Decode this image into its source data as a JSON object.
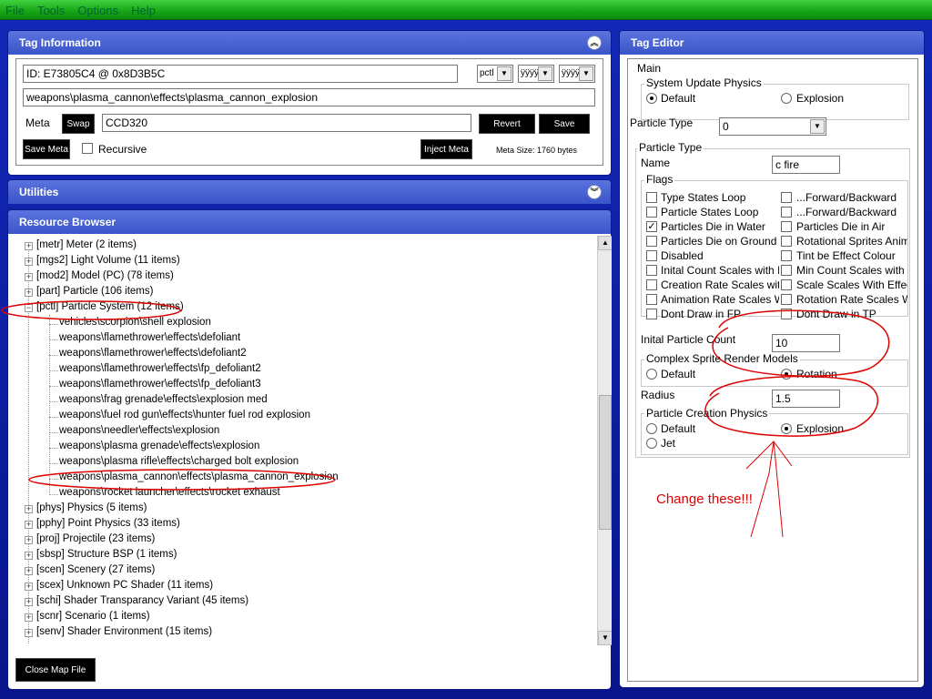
{
  "menu": [
    "File",
    "Tools",
    "Options",
    "Help"
  ],
  "tag_info": {
    "title": "Tag Information",
    "id_value": "ID: E73805C4 @ 0x8D3B5C",
    "type_select": "pctl",
    "select2": "ÿÿÿÿ",
    "select3": "ÿÿÿÿ",
    "path": "weapons\\plasma_cannon\\effects\\plasma_cannon_explosion",
    "meta_label": "Meta",
    "swap_label": "Swap",
    "meta_value": "CCD320",
    "revert_label": "Revert",
    "save_label": "Save",
    "save_meta_label": "Save Meta",
    "recursive_label": "Recursive",
    "inject_meta_label": "Inject Meta",
    "meta_size": "Meta Size: 1760 bytes"
  },
  "utilities": {
    "title": "Utilities"
  },
  "resource_browser": {
    "title": "Resource Browser",
    "close_map_label": "Close Map File",
    "top_items": [
      "[metr] Meter (2 items)",
      "[mgs2] Light Volume (11 items)",
      "[mod2] Model (PC) (78 items)",
      "[part] Particle (106 items)",
      "[pctl] Particle System (12 items)"
    ],
    "children": [
      "vehicles\\scorpion\\shell explosion",
      "weapons\\flamethrower\\effects\\defoliant",
      "weapons\\flamethrower\\effects\\defoliant2",
      "weapons\\flamethrower\\effects\\fp_defoliant2",
      "weapons\\flamethrower\\effects\\fp_defoliant3",
      "weapons\\frag grenade\\effects\\explosion med",
      "weapons\\fuel rod gun\\effects\\hunter fuel rod explosion",
      "weapons\\needler\\effects\\explosion",
      "weapons\\plasma grenade\\effects\\explosion",
      "weapons\\plasma rifle\\effects\\charged bolt explosion",
      "weapons\\plasma_cannon\\effects\\plasma_cannon_explosion",
      "weapons\\rocket launcher\\effects\\rocket exhaust"
    ],
    "bottom_items": [
      "[phys] Physics (5 items)",
      "[pphy] Point Physics (33 items)",
      "[proj] Projectile (23 items)",
      "[sbsp] Structure BSP (1 items)",
      "[scen] Scenery (27 items)",
      "[scex] Unknown PC Shader (11 items)",
      "[schi] Shader Transparancy Variant (45 items)",
      "[scnr] Scenario (1 items)",
      "[senv] Shader Environment (15 items)"
    ]
  },
  "tag_editor": {
    "title": "Tag Editor",
    "main_label": "Main",
    "system_update_physics": "System Update Physics",
    "sup_default": "Default",
    "sup_explosion": "Explosion",
    "particle_type_label": "Particle Type",
    "particle_type_value": "0",
    "particle_type_group": "Particle Type",
    "name_label": "Name",
    "name_value": "c fire",
    "flags_label": "Flags",
    "flags_left": [
      {
        "label": "Type States Loop",
        "checked": false
      },
      {
        "label": "Particle States Loop",
        "checked": false
      },
      {
        "label": "Particles Die in Water",
        "checked": true
      },
      {
        "label": "Particles Die on Ground",
        "checked": false
      },
      {
        "label": "Disabled",
        "checked": false
      },
      {
        "label": "Inital Count Scales with Eff",
        "checked": false
      },
      {
        "label": "Creation Rate Scales with",
        "checked": false
      },
      {
        "label": "Animation Rate Scales Witl",
        "checked": false
      },
      {
        "label": "Dont Draw in FP",
        "checked": false
      }
    ],
    "flags_right": [
      {
        "label": "...Forward/Backward",
        "checked": false
      },
      {
        "label": "...Forward/Backward",
        "checked": false
      },
      {
        "label": "Particles Die in Air",
        "checked": false
      },
      {
        "label": "Rotational Sprites Anima",
        "checked": false
      },
      {
        "label": "Tint be Effect Colour",
        "checked": false
      },
      {
        "label": "Min Count Scales with E",
        "checked": false
      },
      {
        "label": "Scale Scales With Effect",
        "checked": false
      },
      {
        "label": "Rotation Rate Scales Wi",
        "checked": false
      },
      {
        "label": "Dont Draw in TP",
        "checked": false
      }
    ],
    "initial_particle_count_label": "Inital Particle Count",
    "initial_particle_count_value": "10",
    "complex_sprite_label": "Complex Sprite Render Models",
    "csr_default": "Default",
    "csr_rotation": "Rotation",
    "radius_label": "Radius",
    "radius_value": "1.5",
    "creation_physics_label": "Particle Creation Physics",
    "pcp_default": "Default",
    "pcp_explosion": "Explosion",
    "pcp_jet": "Jet"
  },
  "annotation_text": "Change these!!!",
  "colors": {
    "accent": "#3a55c8",
    "annotation": "#dd0000",
    "topbar": "#16a416"
  }
}
